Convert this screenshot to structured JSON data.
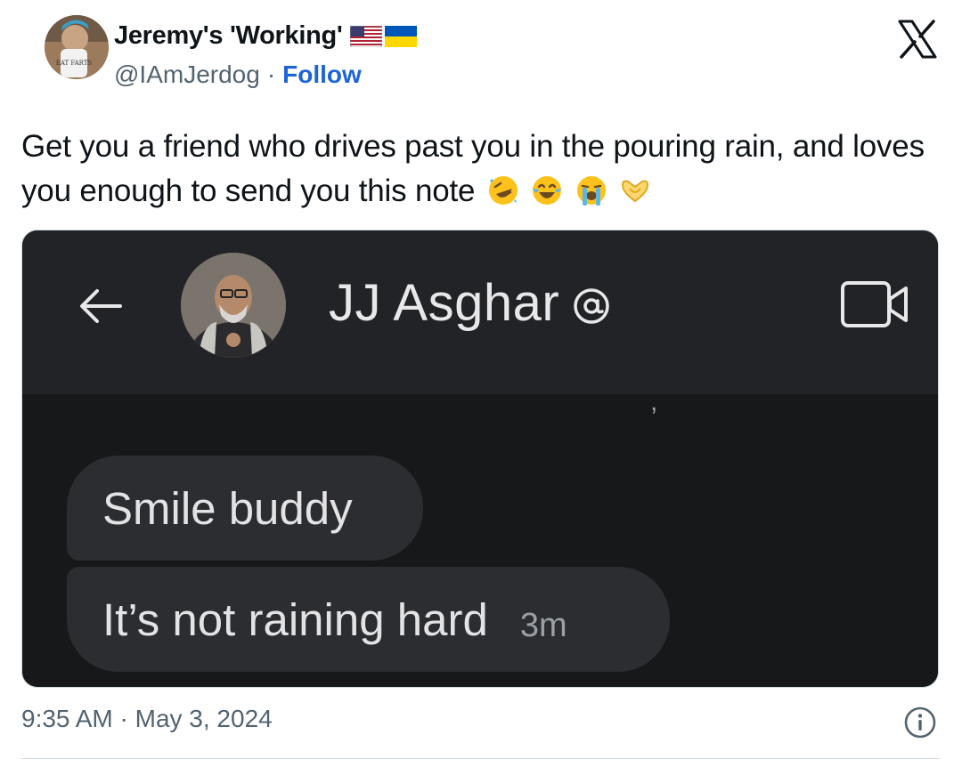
{
  "tweet": {
    "display_name": "Jeremy's 'Working'",
    "flags": [
      "us-flag-icon",
      "ukraine-flag-icon"
    ],
    "handle": "@IAmJerdog",
    "separator": "·",
    "follow_label": "Follow",
    "mug_text": "EAT FARTS",
    "text": "Get you a friend who drives past you in the pouring rain, and loves you enough to send you this note",
    "text_emojis": [
      "rolling-on-floor-laughing-emoji",
      "face-with-tears-of-joy-emoji",
      "loudly-crying-face-emoji",
      "heart-hands-emoji"
    ],
    "timestamp": "9:35 AM · May 3, 2024"
  },
  "embedded_chat": {
    "contact_name": "JJ Asghar",
    "partial_text": ",",
    "messages": [
      {
        "text": "Smile buddy",
        "time": ""
      },
      {
        "text": "It’s not raining hard",
        "time": "3m"
      }
    ]
  },
  "colors": {
    "follow": "#1d64d8",
    "secondary_text": "#536471",
    "chat_bg": "#17181a",
    "chat_header": "#222327",
    "bubble": "#2c2d31"
  }
}
